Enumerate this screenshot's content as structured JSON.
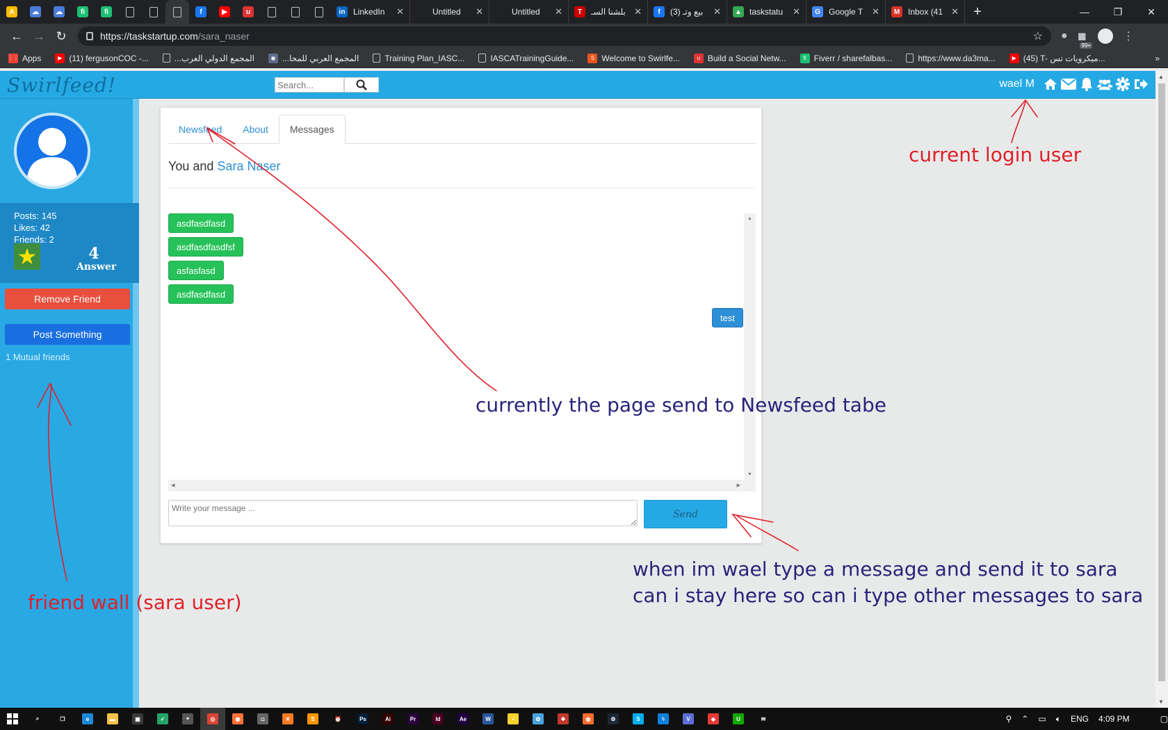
{
  "browser": {
    "tabs": [
      {
        "type": "pinned",
        "icon": "google-ads-icon",
        "color": "#fbbc04",
        "glyph": "A"
      },
      {
        "type": "pinned",
        "icon": "cloud-icon",
        "color": "#4a7bd8",
        "glyph": "☁"
      },
      {
        "type": "pinned",
        "icon": "cloud-icon",
        "color": "#4a7bd8",
        "glyph": "☁"
      },
      {
        "type": "pinned",
        "icon": "fiverr-icon",
        "color": "#1dbf73",
        "glyph": "fi"
      },
      {
        "type": "pinned",
        "icon": "fiverr-icon",
        "color": "#1dbf73",
        "glyph": "fi"
      },
      {
        "type": "pinned",
        "icon": "page-icon",
        "color": "doc",
        "glyph": ""
      },
      {
        "type": "pinned",
        "icon": "page-icon",
        "color": "doc",
        "glyph": ""
      },
      {
        "type": "pinned",
        "icon": "page-icon",
        "color": "doc",
        "glyph": "",
        "active": true
      },
      {
        "type": "pinned",
        "icon": "facebook-icon",
        "color": "#1877f2",
        "glyph": "f"
      },
      {
        "type": "pinned",
        "icon": "youtube-icon",
        "color": "#ff0000",
        "glyph": "▶"
      },
      {
        "type": "pinned",
        "icon": "udemy-icon",
        "color": "#d33",
        "glyph": "u"
      },
      {
        "type": "pinned",
        "icon": "page-icon",
        "color": "doc",
        "glyph": ""
      },
      {
        "type": "pinned",
        "icon": "page-icon",
        "color": "doc",
        "glyph": ""
      },
      {
        "type": "pinned",
        "icon": "page-icon",
        "color": "doc",
        "glyph": ""
      },
      {
        "type": "wide",
        "icon": "linkedin-icon",
        "color": "#0a66c2",
        "glyph": "in",
        "label": "LinkedIn"
      },
      {
        "type": "wide",
        "icon": "none",
        "color": "transparent",
        "glyph": "",
        "label": "Untitled"
      },
      {
        "type": "wide",
        "icon": "none",
        "color": "transparent",
        "glyph": "",
        "label": "Untitled"
      },
      {
        "type": "wide",
        "icon": "toyota-icon",
        "color": "#c00",
        "glyph": "T",
        "label": "بلشنا السـ"
      },
      {
        "type": "wide",
        "icon": "facebook-icon",
        "color": "#1877f2",
        "glyph": "f",
        "label": "(3) بيع وتـ"
      },
      {
        "type": "wide",
        "icon": "google-drive-icon",
        "color": "#34a853",
        "glyph": "▲",
        "label": "taskstatu"
      },
      {
        "type": "wide",
        "icon": "google-translate-icon",
        "color": "#4285f4",
        "glyph": "G",
        "label": "Google T"
      },
      {
        "type": "wide",
        "icon": "gmail-icon",
        "color": "#d93025",
        "glyph": "M",
        "label": "Inbox (41"
      }
    ],
    "url_host": "https://taskstartup.com",
    "url_path": "/sara_naser",
    "ext_badge": "99+",
    "bookmarks": [
      {
        "icon": "apps-grid-icon",
        "color": "#e94235",
        "glyph": "⋮⋮",
        "label": "Apps"
      },
      {
        "icon": "youtube-icon",
        "color": "#ff0000",
        "glyph": "▶",
        "label": "(11) fergusonCOC -..."
      },
      {
        "icon": "page-icon",
        "color": "doc",
        "glyph": "",
        "label": "...المجمع الدولي العرب"
      },
      {
        "icon": "globe-icon",
        "color": "#5f6b8a",
        "glyph": "◉",
        "label": "...المجمع العربي للمحا"
      },
      {
        "icon": "page-icon",
        "color": "doc",
        "glyph": "",
        "label": "Training Plan_IASC..."
      },
      {
        "icon": "page-icon",
        "color": "doc",
        "glyph": "",
        "label": "IASCATrainingGuide..."
      },
      {
        "icon": "swirlfeed-icon",
        "color": "#e8541c",
        "glyph": "S",
        "label": "Welcome to Swirlfe..."
      },
      {
        "icon": "udemy-icon",
        "color": "#d33",
        "glyph": "u",
        "label": "Build a Social Netw..."
      },
      {
        "icon": "fiverr-icon",
        "color": "#1dbf73",
        "glyph": "fi",
        "label": "Fiverr / sharefalbas..."
      },
      {
        "icon": "page-icon",
        "color": "doc",
        "glyph": "",
        "label": "https://www.da3ma..."
      },
      {
        "icon": "youtube-icon",
        "color": "#ff0000",
        "glyph": "▶",
        "label": "(45) T- ميكرويات تس..."
      }
    ]
  },
  "site": {
    "logo": "Swirlfeed!",
    "search_placeholder": "Search...",
    "logged_in_user": "wael M"
  },
  "profile": {
    "posts": "Posts: 145",
    "likes": "Likes: 42",
    "friends": "Friends: 2",
    "answer_count": "4",
    "answer_label": "Answer",
    "remove_friend": "Remove Friend",
    "post_something": "Post Something",
    "mutual_friends": "1 Mutual friends"
  },
  "panel": {
    "tabs": [
      {
        "label": "Newsfeed",
        "active": false
      },
      {
        "label": "About",
        "active": false
      },
      {
        "label": "Messages",
        "active": true
      }
    ],
    "conversation_prefix": "You and ",
    "conversation_friend": "Sara Naser",
    "messages": [
      {
        "text": "asdfasdfasd",
        "direction": "in"
      },
      {
        "text": "asdfasdfasdfsf",
        "direction": "in"
      },
      {
        "text": "asfasfasd",
        "direction": "in"
      },
      {
        "text": "asdfasdfasd",
        "direction": "in"
      },
      {
        "text": "test",
        "direction": "out"
      }
    ],
    "message_placeholder": "Write your message ...",
    "send_label": "Send"
  },
  "annotations": {
    "login_user": "current login user",
    "newsfeed": "currently the page send to Newsfeed tabe",
    "friend_wall": "friend wall (sara user)",
    "send_line1": "when im wael type a message and send it to sara",
    "send_line2": "can i stay here so can i type other messages to sara"
  },
  "taskbar": {
    "apps": [
      {
        "icon": "search-icon",
        "color": "transparent",
        "glyph": "⌕"
      },
      {
        "icon": "task-view-icon",
        "color": "transparent",
        "glyph": "❒"
      },
      {
        "icon": "edge-icon",
        "color": "#1b88d8",
        "glyph": "e"
      },
      {
        "icon": "file-explorer-icon",
        "color": "#f6c34a",
        "glyph": "▬"
      },
      {
        "icon": "store-icon",
        "color": "#3a3a3a",
        "glyph": "▣"
      },
      {
        "icon": "shield-icon",
        "color": "#26a269",
        "glyph": "✓"
      },
      {
        "icon": "maps-icon",
        "color": "#555",
        "glyph": "⌖"
      },
      {
        "icon": "chrome-icon",
        "color": "#db4437",
        "glyph": "◎",
        "active": true
      },
      {
        "icon": "firefox-icon",
        "color": "#ff7139",
        "glyph": "◉"
      },
      {
        "icon": "camera-icon",
        "color": "#666",
        "glyph": "◘"
      },
      {
        "icon": "xampp-icon",
        "color": "#fb7a24",
        "glyph": "✕"
      },
      {
        "icon": "sublime-icon",
        "color": "#ff9800",
        "glyph": "S"
      },
      {
        "icon": "alarm-icon",
        "color": "transparent",
        "glyph": "⏰"
      },
      {
        "icon": "photoshop-icon",
        "color": "#001e36",
        "glyph": "Ps"
      },
      {
        "icon": "illustrator-icon",
        "color": "#330000",
        "glyph": "Ai"
      },
      {
        "icon": "premiere-icon",
        "color": "#2a003f",
        "glyph": "Pr"
      },
      {
        "icon": "indesign-icon",
        "color": "#49021f",
        "glyph": "Id"
      },
      {
        "icon": "after-effects-icon",
        "color": "#1f0040",
        "glyph": "Ae"
      },
      {
        "icon": "word-icon",
        "color": "#2b579a",
        "glyph": "W"
      },
      {
        "icon": "sticky-notes-icon",
        "color": "#f7d22e",
        "glyph": "▪"
      },
      {
        "icon": "gear-app-icon",
        "color": "#4aa3df",
        "glyph": "✿"
      },
      {
        "icon": "popcorn-icon",
        "color": "#c0392b",
        "glyph": "❖"
      },
      {
        "icon": "origin-icon",
        "color": "#f56c2d",
        "glyph": "◍"
      },
      {
        "icon": "steam-icon",
        "color": "#1b2838",
        "glyph": "⚙"
      },
      {
        "icon": "skype-icon",
        "color": "#00aff0",
        "glyph": "S"
      },
      {
        "icon": "bolt-icon",
        "color": "#0e7fd8",
        "glyph": "ϟ"
      },
      {
        "icon": "v-icon",
        "color": "#5b6fd6",
        "glyph": "V"
      },
      {
        "icon": "anydesk-icon",
        "color": "#e53935",
        "glyph": "◆"
      },
      {
        "icon": "upwork-icon",
        "color": "#14a800",
        "glyph": "U"
      },
      {
        "icon": "mail-icon",
        "color": "transparent",
        "glyph": "✉"
      }
    ],
    "language": "ENG",
    "time": "4:09 PM"
  }
}
